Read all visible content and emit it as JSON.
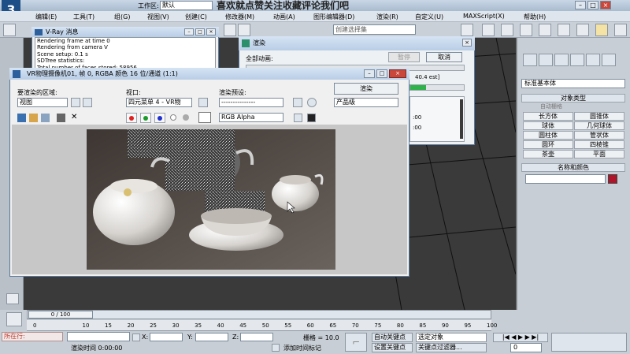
{
  "app": {
    "workspace_label": "工作区:",
    "workspace_value": "默认",
    "overlay_text": "喜欢就点赞关注收藏评论我们吧",
    "controls": [
      "–",
      "□",
      "×"
    ]
  },
  "menu": [
    "编辑(E)",
    "工具(T)",
    "组(G)",
    "视图(V)",
    "创建(C)",
    "修改器(M)",
    "动画(A)",
    "图形编辑器(D)",
    "渲染(R)",
    "自定义(U)",
    "MAXScript(X)",
    "帮助(H)"
  ],
  "toolbar": {
    "selection_set_placeholder": "创建选择集"
  },
  "vray_messages": {
    "title": "V-Ray 消息",
    "lines": [
      "Rendering frame at time 0",
      "Rendering from camera V",
      "Scene setup: 0.1 s",
      "SDTree statistics:",
      "Total number of faces stored: 58956"
    ]
  },
  "render_dialog": {
    "title": "渲染",
    "all_animation": "全部动画:",
    "pause": "暂停",
    "cancel": "取消",
    "partial_est": "40.4 est]",
    "time1": ":00",
    "time2": ":00"
  },
  "vfb": {
    "title": "VR物理摄像机01, 帧 0, RGBA 颜色 16 位/通道 (1:1)",
    "area_label": "要渲染的区域:",
    "area_value": "视图",
    "viewport_label": "视口:",
    "viewport_value": "四元菜单 4 - VR物",
    "preset_label": "渲染预设:",
    "preset_value": "---------------",
    "render_button": "渲染",
    "quality_value": "产品级",
    "channel_value": "RGB Alpha"
  },
  "command_panel": {
    "category": "标准基本体",
    "object_type_header": "对象类型",
    "autogrid": "自动栅格",
    "buttons": [
      "长方体",
      "圆锥体",
      "球体",
      "几何球体",
      "圆柱体",
      "管状体",
      "圆环",
      "四棱锥",
      "茶壶",
      "平面"
    ],
    "name_color_header": "名称和颜色"
  },
  "timeline": {
    "thumb": "0 / 100",
    "ticks": [
      "0",
      "10",
      "15",
      "20",
      "25",
      "30",
      "35",
      "40",
      "45",
      "50",
      "55",
      "60",
      "65",
      "70",
      "75",
      "80",
      "85",
      "90",
      "95",
      "100"
    ]
  },
  "status": {
    "location": "所在行:",
    "render_time": "渲染时间 0:00:00",
    "x_label": "X:",
    "y_label": "Y:",
    "z_label": "Z:",
    "grid": "栅格 = 10.0",
    "add_time_tag": "添加时间标记",
    "auto_key": "自动关键点",
    "set_key": "设置关键点",
    "selected_object": "选定对象",
    "key_filters": "关键点过滤器...",
    "frame_value": "0"
  },
  "colors": {
    "accent": "#1e4f86",
    "swatch": "#b0142a",
    "progress": "#2fb24a"
  }
}
